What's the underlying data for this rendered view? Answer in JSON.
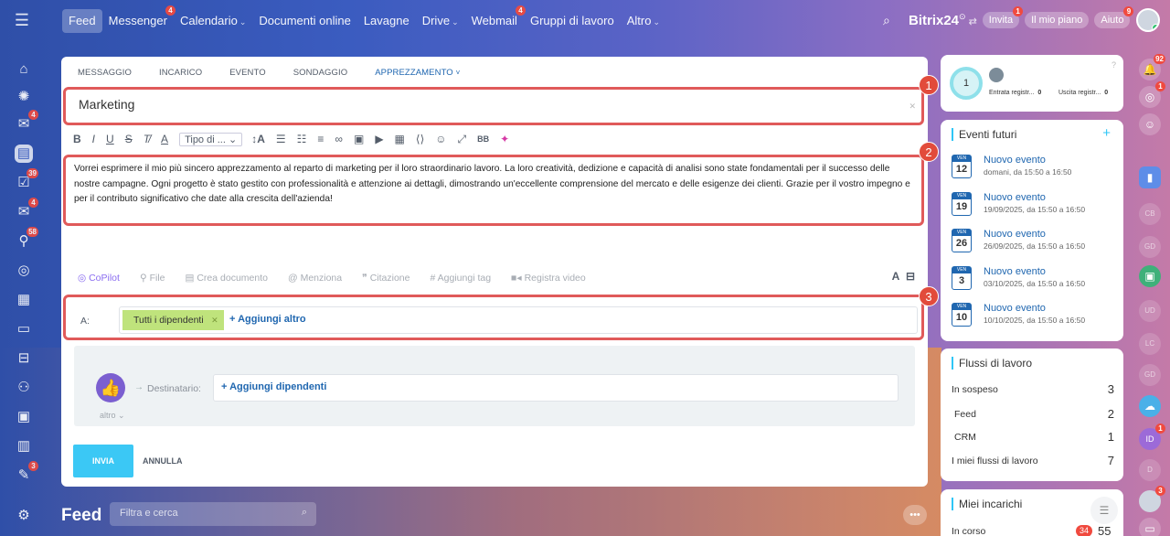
{
  "topbar": {
    "nav": [
      {
        "label": "Feed",
        "active": true,
        "badge": ""
      },
      {
        "label": "Messenger",
        "badge": "4"
      },
      {
        "label": "Calendario",
        "chevron": true,
        "badge": ""
      },
      {
        "label": "Documenti online",
        "badge": ""
      },
      {
        "label": "Lavagne",
        "badge": ""
      },
      {
        "label": "Drive",
        "chevron": true,
        "badge": ""
      },
      {
        "label": "Webmail",
        "badge": "4"
      },
      {
        "label": "Gruppi di lavoro",
        "badge": ""
      },
      {
        "label": "Altro",
        "chevron": true,
        "badge": ""
      }
    ],
    "brand": "Bitrix",
    "brand_num": "24",
    "invite": {
      "label": "Invita",
      "badge": "1"
    },
    "plan": {
      "label": "Il mio piano"
    },
    "help": {
      "label": "Aiuto",
      "badge": "9"
    }
  },
  "left_rail": {
    "badges": {
      "chat": "4",
      "tasks": "39",
      "mail": "4",
      "filter": "58",
      "bp": "3"
    }
  },
  "composer": {
    "tabs": [
      "MESSAGGIO",
      "INCARICO",
      "EVENTO",
      "SONDAGGIO",
      "APPREZZAMENTO"
    ],
    "active_tab_suffix": "˅",
    "title": "Marketing",
    "toolbar_select": "Tipo di ...",
    "body": "Vorrei esprimere il mio più sincero apprezzamento al reparto di marketing per il loro straordinario lavoro. La loro creatività, dedizione e capacità di analisi sono state fondamentali per il successo delle nostre campagne. Ogni progetto è stato gestito con professionalità e attenzione ai dettagli, dimostrando un'eccellente comprensione del mercato e delle esigenze dei clienti. Grazie per il vostro impegno e per il contributo significativo che date alla crescita dell'azienda!",
    "actions": [
      "CoPilot",
      "File",
      "Crea documento",
      "Menziona",
      "Citazione",
      "Aggiungi tag",
      "Registra video"
    ],
    "to_label": "A:",
    "recipient_chip": "Tutti i dipendenti",
    "add_more": "+ Aggiungi altro",
    "dest_label": "Destinatario:",
    "add_employees": "+ Aggiungi dipendenti",
    "altro": "altro",
    "send": "INVIA",
    "cancel": "ANNULLA",
    "callouts": [
      "1",
      "2",
      "3"
    ]
  },
  "feed": {
    "title": "Feed",
    "filter_placeholder": "Filtra e cerca"
  },
  "widgets": {
    "timeman": {
      "count": "1",
      "in_label": "Entrata registr...",
      "in_val": "0",
      "out_label": "Uscita registr...",
      "out_val": "0"
    },
    "events": {
      "title": "Eventi futuri",
      "items": [
        {
          "dow": "VEN",
          "day": "12",
          "title": "Nuovo evento",
          "when": "domani, da 15:50 a 16:50"
        },
        {
          "dow": "VEN",
          "day": "19",
          "title": "Nuovo evento",
          "when": "19/09/2025, da 15:50 a 16:50"
        },
        {
          "dow": "VEN",
          "day": "26",
          "title": "Nuovo evento",
          "when": "26/09/2025, da 15:50 a 16:50"
        },
        {
          "dow": "VEN",
          "day": "3",
          "title": "Nuovo evento",
          "when": "03/10/2025, da 15:50 a 16:50"
        },
        {
          "dow": "VEN",
          "day": "10",
          "title": "Nuovo evento",
          "when": "10/10/2025, da 15:50 a 16:50"
        }
      ]
    },
    "workflows": {
      "title": "Flussi di lavoro",
      "rows": [
        {
          "label": "In sospeso",
          "value": "3"
        },
        {
          "label": "Feed",
          "value": "2"
        },
        {
          "label": "CRM",
          "value": "1"
        },
        {
          "label": "I miei flussi di lavoro",
          "value": "7"
        }
      ]
    },
    "tasks": {
      "title": "Miei incarichi",
      "row_label": "In corso",
      "badge": "34",
      "value": "55"
    }
  },
  "right_rail": {
    "badges": {
      "notify": "92",
      "pulse": "1",
      "user": "1",
      "avatar": "3"
    },
    "ghosts": [
      "CB",
      "GD",
      "UD",
      "LC",
      "GD",
      "D"
    ],
    "id_label": "ID"
  }
}
